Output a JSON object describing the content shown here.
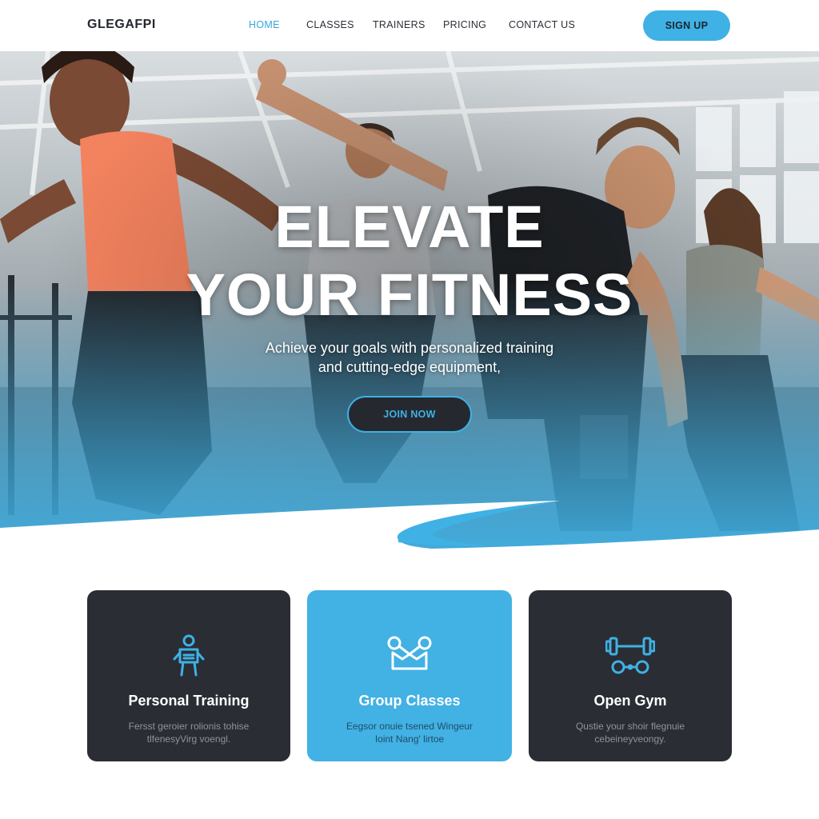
{
  "brand": {
    "logo": "GLEGAFPI"
  },
  "nav": {
    "items": [
      {
        "label": "HOME",
        "active": true
      },
      {
        "label": "CLASSES",
        "active": false
      },
      {
        "label": "TRAINERS",
        "active": false
      },
      {
        "label": "PRICING",
        "active": false
      },
      {
        "label": "CONTACT US",
        "active": false
      }
    ],
    "signup_label": "SIGN UP"
  },
  "hero": {
    "headline_line1": "ELEVATE",
    "headline_line2": "YOUR FITNESS",
    "subtitle_line1": "Achieve your goals with personalized training",
    "subtitle_line2": "and cutting-edge equipment,",
    "cta_label": "JOIN NOW"
  },
  "cards": [
    {
      "icon": "trainer-icon",
      "title": "Personal Training",
      "desc_line1": "Fersst geroier rolionis tohise",
      "desc_line2": "tlfenesyVirg voengl.",
      "style": "dark"
    },
    {
      "icon": "group-icon",
      "title": "Group Classes",
      "desc_line1": "Eegsor onuie tsened Wingeur",
      "desc_line2": "Ioint Nang' lirtoe",
      "style": "blue"
    },
    {
      "icon": "dumbbell-icon",
      "title": "Open Gym",
      "desc_line1": "Qustie your shoir flegnuie",
      "desc_line2": "cebeineyveongy.",
      "style": "dark"
    }
  ],
  "colors": {
    "accent": "#3fb1e5",
    "dark_card": "#2a2d33",
    "text_dark": "#23272e"
  }
}
